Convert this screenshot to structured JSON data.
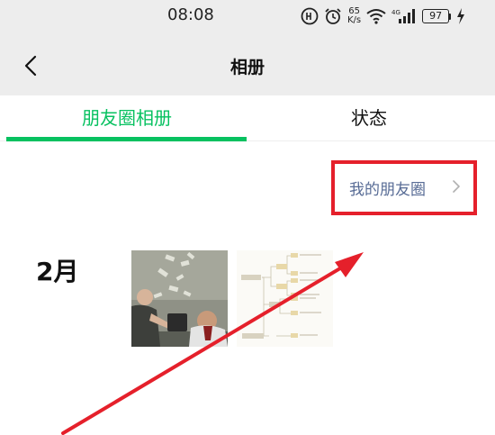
{
  "status_bar": {
    "time": "08:08",
    "net_speed_value": "65",
    "net_speed_unit": "K/s",
    "network_type": "4G",
    "battery": "97",
    "icons": [
      "hd-icon",
      "alarm-icon",
      "wifi-icon",
      "signal-icon",
      "battery-icon",
      "charging-icon"
    ]
  },
  "navbar": {
    "back_icon": "chevron-left-icon",
    "title": "相册"
  },
  "tabs": [
    {
      "label": "朋友圈相册",
      "active": true
    },
    {
      "label": "状态",
      "active": false
    }
  ],
  "my_moments": {
    "label": "我的朋友圈",
    "icon": "chevron-right-icon"
  },
  "album": {
    "month": "2月",
    "thumbnails": [
      {
        "name": "photo-thumbnail",
        "icon": "photo-icon"
      },
      {
        "name": "mindmap-thumbnail",
        "icon": "mindmap-icon"
      }
    ]
  },
  "colors": {
    "accent_green": "#07c160",
    "link_blue": "#576b95",
    "highlight_red": "#e5202b",
    "bar_gray": "#ededed"
  }
}
